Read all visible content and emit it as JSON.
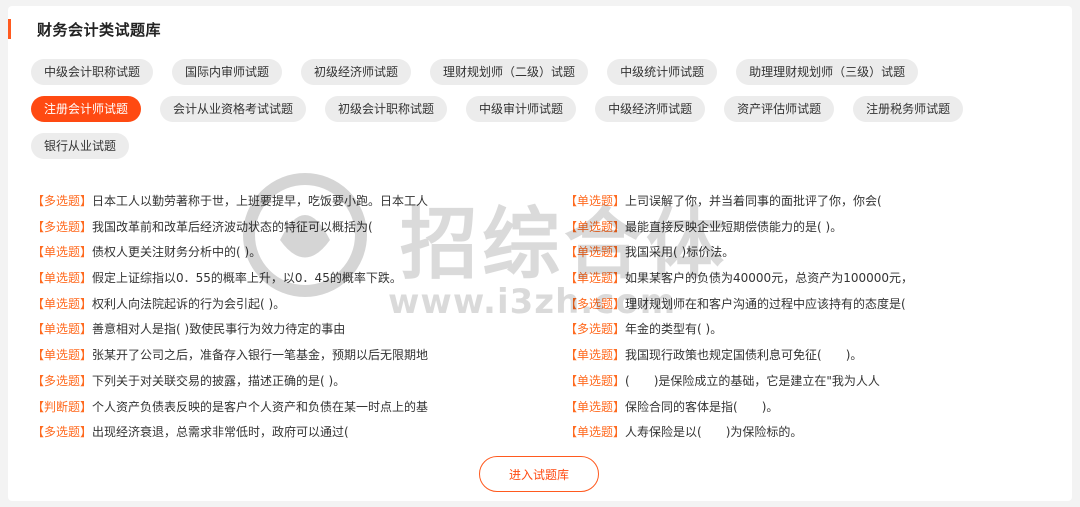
{
  "section": {
    "title": "财务会计类试题库"
  },
  "tag_rows": [
    [
      "中级会计职称试题",
      "国际内审师试题",
      "初级经济师试题",
      "理财规划师（二级）试题",
      "中级统计师试题",
      "助理理财规划师（三级）试题"
    ],
    [
      "注册会计师试题",
      "会计从业资格考试试题",
      "初级会计职称试题",
      "中级审计师试题",
      "中级经济师试题",
      "资产评估师试题",
      "注册税务师试题"
    ],
    [
      "银行从业试题"
    ]
  ],
  "active_tag": "注册会计师试题",
  "questions_left": [
    {
      "type": "【多选题】",
      "text": "日本工人以勤劳著称于世，上班要提早，吃饭要小跑。日本工人"
    },
    {
      "type": "【多选题】",
      "text": "我国改革前和改革后经济波动状态的特征可以概括为("
    },
    {
      "type": "【单选题】",
      "text": "债权人更关注财务分析中的( )。"
    },
    {
      "type": "【单选题】",
      "text": "假定上证综指以0．55的概率上升，以0．45的概率下跌。"
    },
    {
      "type": "【单选题】",
      "text": "权利人向法院起诉的行为会引起( )。"
    },
    {
      "type": "【单选题】",
      "text": "善意相对人是指( )致使民事行为效力待定的事由"
    },
    {
      "type": "【单选题】",
      "text": "张某开了公司之后，准备存入银行一笔基金，预期以后无限期地"
    },
    {
      "type": "【多选题】",
      "text": "下列关于对关联交易的披露，描述正确的是( )。"
    },
    {
      "type": "【判断题】",
      "text": "个人资产负债表反映的是客户个人资产和负债在某一时点上的基"
    },
    {
      "type": "【多选题】",
      "text": "出现经济衰退，总需求非常低时，政府可以通过("
    }
  ],
  "questions_right": [
    {
      "type": "【单选题】",
      "text": "上司误解了你，并当着同事的面批评了你，你会("
    },
    {
      "type": "【单选题】",
      "text": "最能直接反映企业短期偿债能力的是( )。"
    },
    {
      "type": "【单选题】",
      "text": "我国采用( )标价法。"
    },
    {
      "type": "【单选题】",
      "text": "如果某客户的负债为40000元，总资产为100000元，"
    },
    {
      "type": "【多选题】",
      "text": "理财规划师在和客户沟通的过程中应该持有的态度是("
    },
    {
      "type": "【多选题】",
      "text": "年金的类型有( )。"
    },
    {
      "type": "【单选题】",
      "text": "我国现行政策也规定国债利息可免征(　　)。"
    },
    {
      "type": "【单选题】",
      "text": "(　　)是保险成立的基础，它是建立在\"我为人人"
    },
    {
      "type": "【单选题】",
      "text": "保险合同的客体是指(　　)。"
    },
    {
      "type": "【单选题】",
      "text": "人寿保险是以(　　)为保险标的。"
    }
  ],
  "enter_button": "进入试题库",
  "watermark": {
    "text": "招综合体",
    "url": "www.i3zh.com"
  },
  "colors": {
    "accent": "#ff4a12",
    "question_type": "#ff6a1f",
    "tag_bg": "#ececec"
  }
}
